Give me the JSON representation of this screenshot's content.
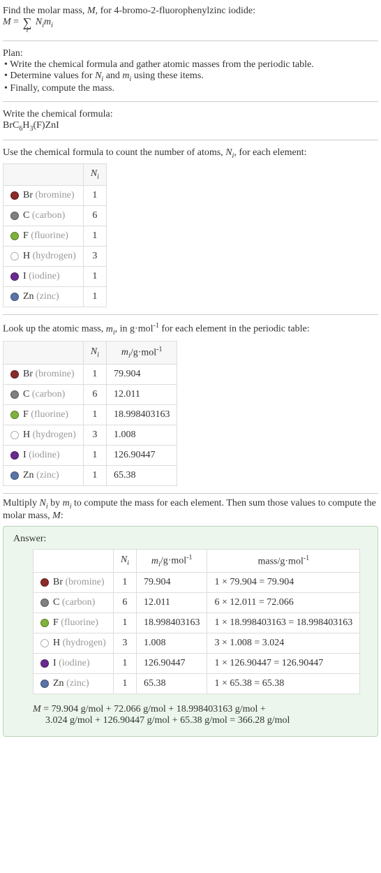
{
  "intro": {
    "line1": "Find the molar mass, ",
    "mvar": "M",
    "line1b": ", for 4-bromo-2-fluorophenylzinc iodide:",
    "eq_lhs": "M",
    "eq_rhs_tail": "N",
    "eq_rhs_tail2": "m"
  },
  "plan": {
    "heading": "Plan:",
    "items": [
      "• Write the chemical formula and gather atomic masses from the periodic table.",
      "• Determine values for Nᵢ and mᵢ using these items.",
      "• Finally, compute the mass."
    ]
  },
  "formula": {
    "heading": "Write the chemical formula:",
    "text": "BrC₆H₃(F)ZnI"
  },
  "count": {
    "heading_a": "Use the chemical formula to count the number of atoms, ",
    "heading_var": "N",
    "heading_b": ", for each element:",
    "col_n": "Nᵢ",
    "rows": [
      {
        "color": "#8b2a2a",
        "sym": "Br",
        "name": "(bromine)",
        "n": "1"
      },
      {
        "color": "#808080",
        "sym": "C",
        "name": "(carbon)",
        "n": "6"
      },
      {
        "color": "#7fb23d",
        "sym": "F",
        "name": "(fluorine)",
        "n": "1"
      },
      {
        "color": "#ffffff",
        "sym": "H",
        "name": "(hydrogen)",
        "n": "3"
      },
      {
        "color": "#6b2a8f",
        "sym": "I",
        "name": "(iodine)",
        "n": "1"
      },
      {
        "color": "#5a74a8",
        "sym": "Zn",
        "name": "(zinc)",
        "n": "1"
      }
    ]
  },
  "masses": {
    "heading_a": "Look up the atomic mass, ",
    "heading_var": "m",
    "heading_b": ", in g·mol",
    "heading_c": " for each element in the periodic table:",
    "col_n": "Nᵢ",
    "col_m": "mᵢ/g·mol⁻¹",
    "rows": [
      {
        "color": "#8b2a2a",
        "sym": "Br",
        "name": "(bromine)",
        "n": "1",
        "m": "79.904"
      },
      {
        "color": "#808080",
        "sym": "C",
        "name": "(carbon)",
        "n": "6",
        "m": "12.011"
      },
      {
        "color": "#7fb23d",
        "sym": "F",
        "name": "(fluorine)",
        "n": "1",
        "m": "18.998403163"
      },
      {
        "color": "#ffffff",
        "sym": "H",
        "name": "(hydrogen)",
        "n": "3",
        "m": "1.008"
      },
      {
        "color": "#6b2a8f",
        "sym": "I",
        "name": "(iodine)",
        "n": "1",
        "m": "126.90447"
      },
      {
        "color": "#5a74a8",
        "sym": "Zn",
        "name": "(zinc)",
        "n": "1",
        "m": "65.38"
      }
    ]
  },
  "multiply": {
    "heading_a": "Multiply ",
    "heading_b": " by ",
    "heading_c": " to compute the mass for each element. Then sum those values to compute the molar mass, ",
    "heading_d": ":"
  },
  "answer": {
    "label": "Answer:",
    "col_n": "Nᵢ",
    "col_m": "mᵢ/g·mol⁻¹",
    "col_mass": "mass/g·mol⁻¹",
    "rows": [
      {
        "color": "#8b2a2a",
        "sym": "Br",
        "name": "(bromine)",
        "n": "1",
        "m": "79.904",
        "mass": "1 × 79.904 = 79.904"
      },
      {
        "color": "#808080",
        "sym": "C",
        "name": "(carbon)",
        "n": "6",
        "m": "12.011",
        "mass": "6 × 12.011 = 72.066"
      },
      {
        "color": "#7fb23d",
        "sym": "F",
        "name": "(fluorine)",
        "n": "1",
        "m": "18.998403163",
        "mass": "1 × 18.998403163 = 18.998403163"
      },
      {
        "color": "#ffffff",
        "sym": "H",
        "name": "(hydrogen)",
        "n": "3",
        "m": "1.008",
        "mass": "3 × 1.008 = 3.024"
      },
      {
        "color": "#6b2a8f",
        "sym": "I",
        "name": "(iodine)",
        "n": "1",
        "m": "126.90447",
        "mass": "1 × 126.90447 = 126.90447"
      },
      {
        "color": "#5a74a8",
        "sym": "Zn",
        "name": "(zinc)",
        "n": "1",
        "m": "65.38",
        "mass": "1 × 65.38 = 65.38"
      }
    ],
    "sum_line1": "M = 79.904 g/mol + 72.066 g/mol + 18.998403163 g/mol +",
    "sum_line2": "3.024 g/mol + 126.90447 g/mol + 65.38 g/mol = 366.28 g/mol"
  }
}
